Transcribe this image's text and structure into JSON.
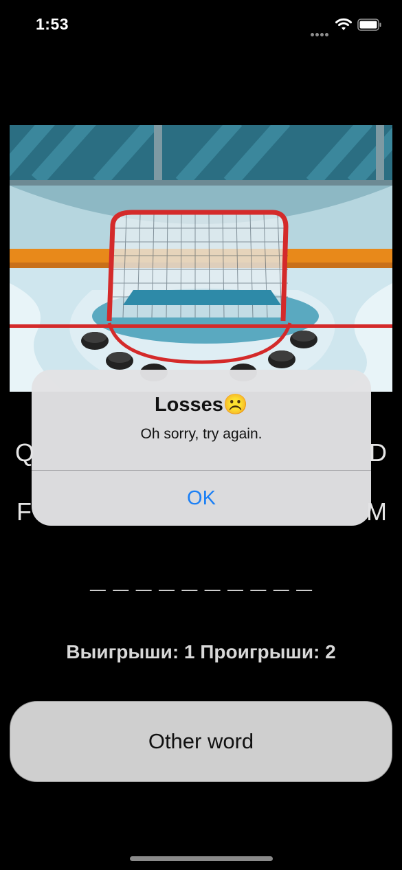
{
  "status_bar": {
    "time": "1:53"
  },
  "keyboard": {
    "row1_first": "Q",
    "row1_last": "D",
    "row2_first": "F",
    "row2_last": "M"
  },
  "word_blanks": "_ _ _ _ _ _ _ _ _ _",
  "score_text": "Выигрыши: 1 Проигрыши: 2",
  "other_word_label": "Other word",
  "alert": {
    "title": "Losses",
    "title_emoji": "☹️",
    "message": "Oh sorry, try again.",
    "ok_label": "OK"
  },
  "colors": {
    "accent": "#1a7ff5",
    "goal_frame": "#d42a2a"
  }
}
